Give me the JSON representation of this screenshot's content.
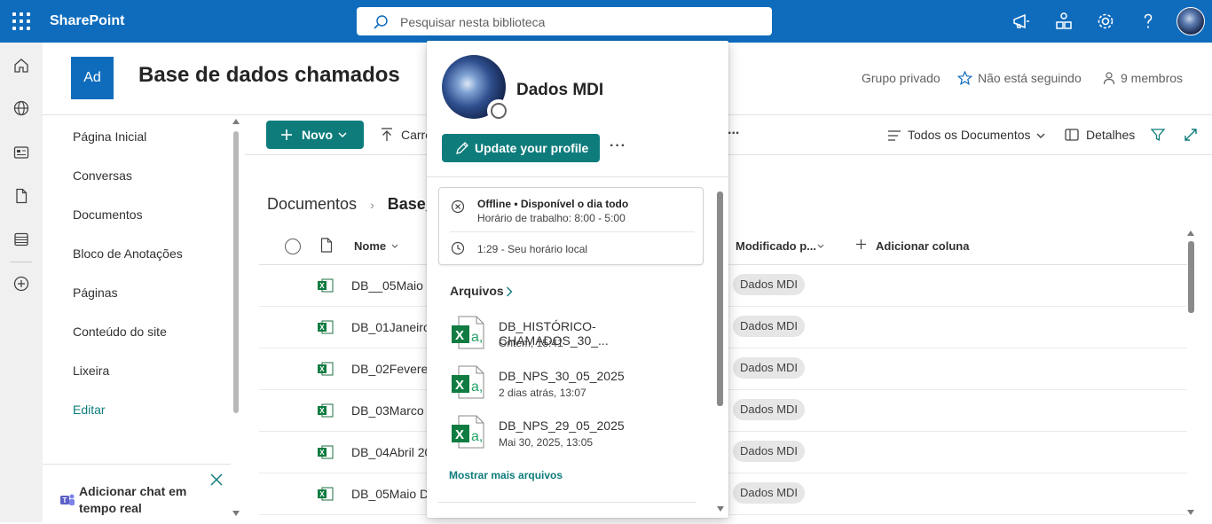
{
  "topbar": {
    "app_name": "SharePoint",
    "search_placeholder": "Pesquisar nesta biblioteca"
  },
  "site": {
    "logo_initials": "Ad",
    "title": "Base de dados chamados",
    "privacy": "Grupo privado",
    "follow": "Não está seguindo",
    "members": "9 membros"
  },
  "nav": {
    "items": [
      "Página Inicial",
      "Conversas",
      "Documentos",
      "Bloco de Anotações",
      "Páginas",
      "Conteúdo do site",
      "Lixeira"
    ],
    "edit": "Editar",
    "chat_label": "Adicionar chat em tempo real"
  },
  "commandbar": {
    "new_label": "Novo",
    "upload_label": "Carre",
    "more": "...",
    "view_label": "Todos os Documentos",
    "details_label": "Detalhes"
  },
  "breadcrumb": {
    "root": "Documentos",
    "current": "Base_"
  },
  "columns": {
    "name": "Nome",
    "modified_by": "Modificado p...",
    "add_column": "Adicionar coluna"
  },
  "rows": [
    {
      "name": "DB__05Maio D",
      "modified_by": "Dados MDI"
    },
    {
      "name": "DB_01Janeiro",
      "modified_by": "Dados MDI"
    },
    {
      "name": "DB_02Fevereir",
      "modified_by": "Dados MDI"
    },
    {
      "name": "DB_03Marco 2",
      "modified_by": "Dados MDI"
    },
    {
      "name": "DB_04Abril 20",
      "modified_by": "Dados MDI"
    },
    {
      "name": "DB_05Maio D",
      "modified_by": "Dados MDI"
    }
  ],
  "profile_card": {
    "name": "Dados MDI",
    "update_button": "Update your profile",
    "more": "···",
    "status": "Offline • Disponível o dia todo",
    "work_hours": "Horário de trabalho: 8:00 - 5:00",
    "local_time": "1:29 - Seu horário local",
    "files_title": "Arquivos",
    "files": [
      {
        "name": "DB_HISTÓRICO-CHAMADOS_30_...",
        "date": "Ontem, 15:41"
      },
      {
        "name": "DB_NPS_30_05_2025",
        "date": "2 dias atrás, 13:07"
      },
      {
        "name": "DB_NPS_29_05_2025",
        "date": "Mai 30, 2025, 13:05"
      }
    ],
    "show_more": "Mostrar mais arquivos"
  },
  "colors": {
    "suite_bar": "#0f6cbd",
    "accent_teal": "#0f7c7c"
  }
}
